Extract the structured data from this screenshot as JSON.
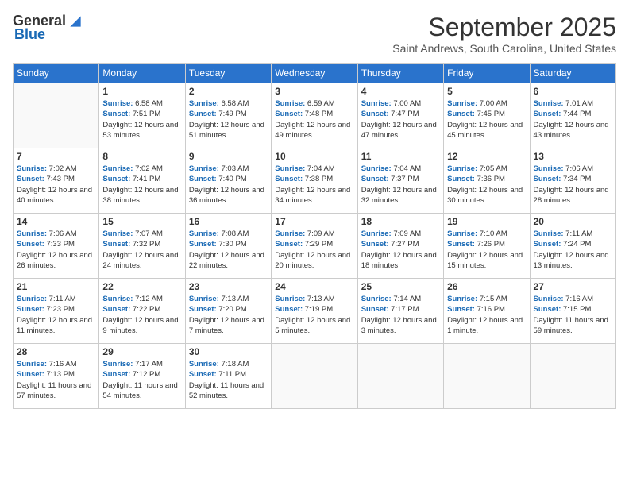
{
  "logo": {
    "general": "General",
    "blue": "Blue"
  },
  "title": "September 2025",
  "location": "Saint Andrews, South Carolina, United States",
  "days_header": [
    "Sunday",
    "Monday",
    "Tuesday",
    "Wednesday",
    "Thursday",
    "Friday",
    "Saturday"
  ],
  "weeks": [
    [
      {
        "day": "",
        "sunrise": "",
        "sunset": "",
        "daylight": ""
      },
      {
        "day": "1",
        "sunrise": "6:58 AM",
        "sunset": "7:51 PM",
        "daylight": "12 hours and 53 minutes."
      },
      {
        "day": "2",
        "sunrise": "6:58 AM",
        "sunset": "7:49 PM",
        "daylight": "12 hours and 51 minutes."
      },
      {
        "day": "3",
        "sunrise": "6:59 AM",
        "sunset": "7:48 PM",
        "daylight": "12 hours and 49 minutes."
      },
      {
        "day": "4",
        "sunrise": "7:00 AM",
        "sunset": "7:47 PM",
        "daylight": "12 hours and 47 minutes."
      },
      {
        "day": "5",
        "sunrise": "7:00 AM",
        "sunset": "7:45 PM",
        "daylight": "12 hours and 45 minutes."
      },
      {
        "day": "6",
        "sunrise": "7:01 AM",
        "sunset": "7:44 PM",
        "daylight": "12 hours and 43 minutes."
      }
    ],
    [
      {
        "day": "7",
        "sunrise": "7:02 AM",
        "sunset": "7:43 PM",
        "daylight": "12 hours and 40 minutes."
      },
      {
        "day": "8",
        "sunrise": "7:02 AM",
        "sunset": "7:41 PM",
        "daylight": "12 hours and 38 minutes."
      },
      {
        "day": "9",
        "sunrise": "7:03 AM",
        "sunset": "7:40 PM",
        "daylight": "12 hours and 36 minutes."
      },
      {
        "day": "10",
        "sunrise": "7:04 AM",
        "sunset": "7:38 PM",
        "daylight": "12 hours and 34 minutes."
      },
      {
        "day": "11",
        "sunrise": "7:04 AM",
        "sunset": "7:37 PM",
        "daylight": "12 hours and 32 minutes."
      },
      {
        "day": "12",
        "sunrise": "7:05 AM",
        "sunset": "7:36 PM",
        "daylight": "12 hours and 30 minutes."
      },
      {
        "day": "13",
        "sunrise": "7:06 AM",
        "sunset": "7:34 PM",
        "daylight": "12 hours and 28 minutes."
      }
    ],
    [
      {
        "day": "14",
        "sunrise": "7:06 AM",
        "sunset": "7:33 PM",
        "daylight": "12 hours and 26 minutes."
      },
      {
        "day": "15",
        "sunrise": "7:07 AM",
        "sunset": "7:32 PM",
        "daylight": "12 hours and 24 minutes."
      },
      {
        "day": "16",
        "sunrise": "7:08 AM",
        "sunset": "7:30 PM",
        "daylight": "12 hours and 22 minutes."
      },
      {
        "day": "17",
        "sunrise": "7:09 AM",
        "sunset": "7:29 PM",
        "daylight": "12 hours and 20 minutes."
      },
      {
        "day": "18",
        "sunrise": "7:09 AM",
        "sunset": "7:27 PM",
        "daylight": "12 hours and 18 minutes."
      },
      {
        "day": "19",
        "sunrise": "7:10 AM",
        "sunset": "7:26 PM",
        "daylight": "12 hours and 15 minutes."
      },
      {
        "day": "20",
        "sunrise": "7:11 AM",
        "sunset": "7:24 PM",
        "daylight": "12 hours and 13 minutes."
      }
    ],
    [
      {
        "day": "21",
        "sunrise": "7:11 AM",
        "sunset": "7:23 PM",
        "daylight": "12 hours and 11 minutes."
      },
      {
        "day": "22",
        "sunrise": "7:12 AM",
        "sunset": "7:22 PM",
        "daylight": "12 hours and 9 minutes."
      },
      {
        "day": "23",
        "sunrise": "7:13 AM",
        "sunset": "7:20 PM",
        "daylight": "12 hours and 7 minutes."
      },
      {
        "day": "24",
        "sunrise": "7:13 AM",
        "sunset": "7:19 PM",
        "daylight": "12 hours and 5 minutes."
      },
      {
        "day": "25",
        "sunrise": "7:14 AM",
        "sunset": "7:17 PM",
        "daylight": "12 hours and 3 minutes."
      },
      {
        "day": "26",
        "sunrise": "7:15 AM",
        "sunset": "7:16 PM",
        "daylight": "12 hours and 1 minute."
      },
      {
        "day": "27",
        "sunrise": "7:16 AM",
        "sunset": "7:15 PM",
        "daylight": "11 hours and 59 minutes."
      }
    ],
    [
      {
        "day": "28",
        "sunrise": "7:16 AM",
        "sunset": "7:13 PM",
        "daylight": "11 hours and 57 minutes."
      },
      {
        "day": "29",
        "sunrise": "7:17 AM",
        "sunset": "7:12 PM",
        "daylight": "11 hours and 54 minutes."
      },
      {
        "day": "30",
        "sunrise": "7:18 AM",
        "sunset": "7:11 PM",
        "daylight": "11 hours and 52 minutes."
      },
      {
        "day": "",
        "sunrise": "",
        "sunset": "",
        "daylight": ""
      },
      {
        "day": "",
        "sunrise": "",
        "sunset": "",
        "daylight": ""
      },
      {
        "day": "",
        "sunrise": "",
        "sunset": "",
        "daylight": ""
      },
      {
        "day": "",
        "sunrise": "",
        "sunset": "",
        "daylight": ""
      }
    ]
  ],
  "labels": {
    "sunrise": "Sunrise:",
    "sunset": "Sunset:",
    "daylight": "Daylight:"
  }
}
